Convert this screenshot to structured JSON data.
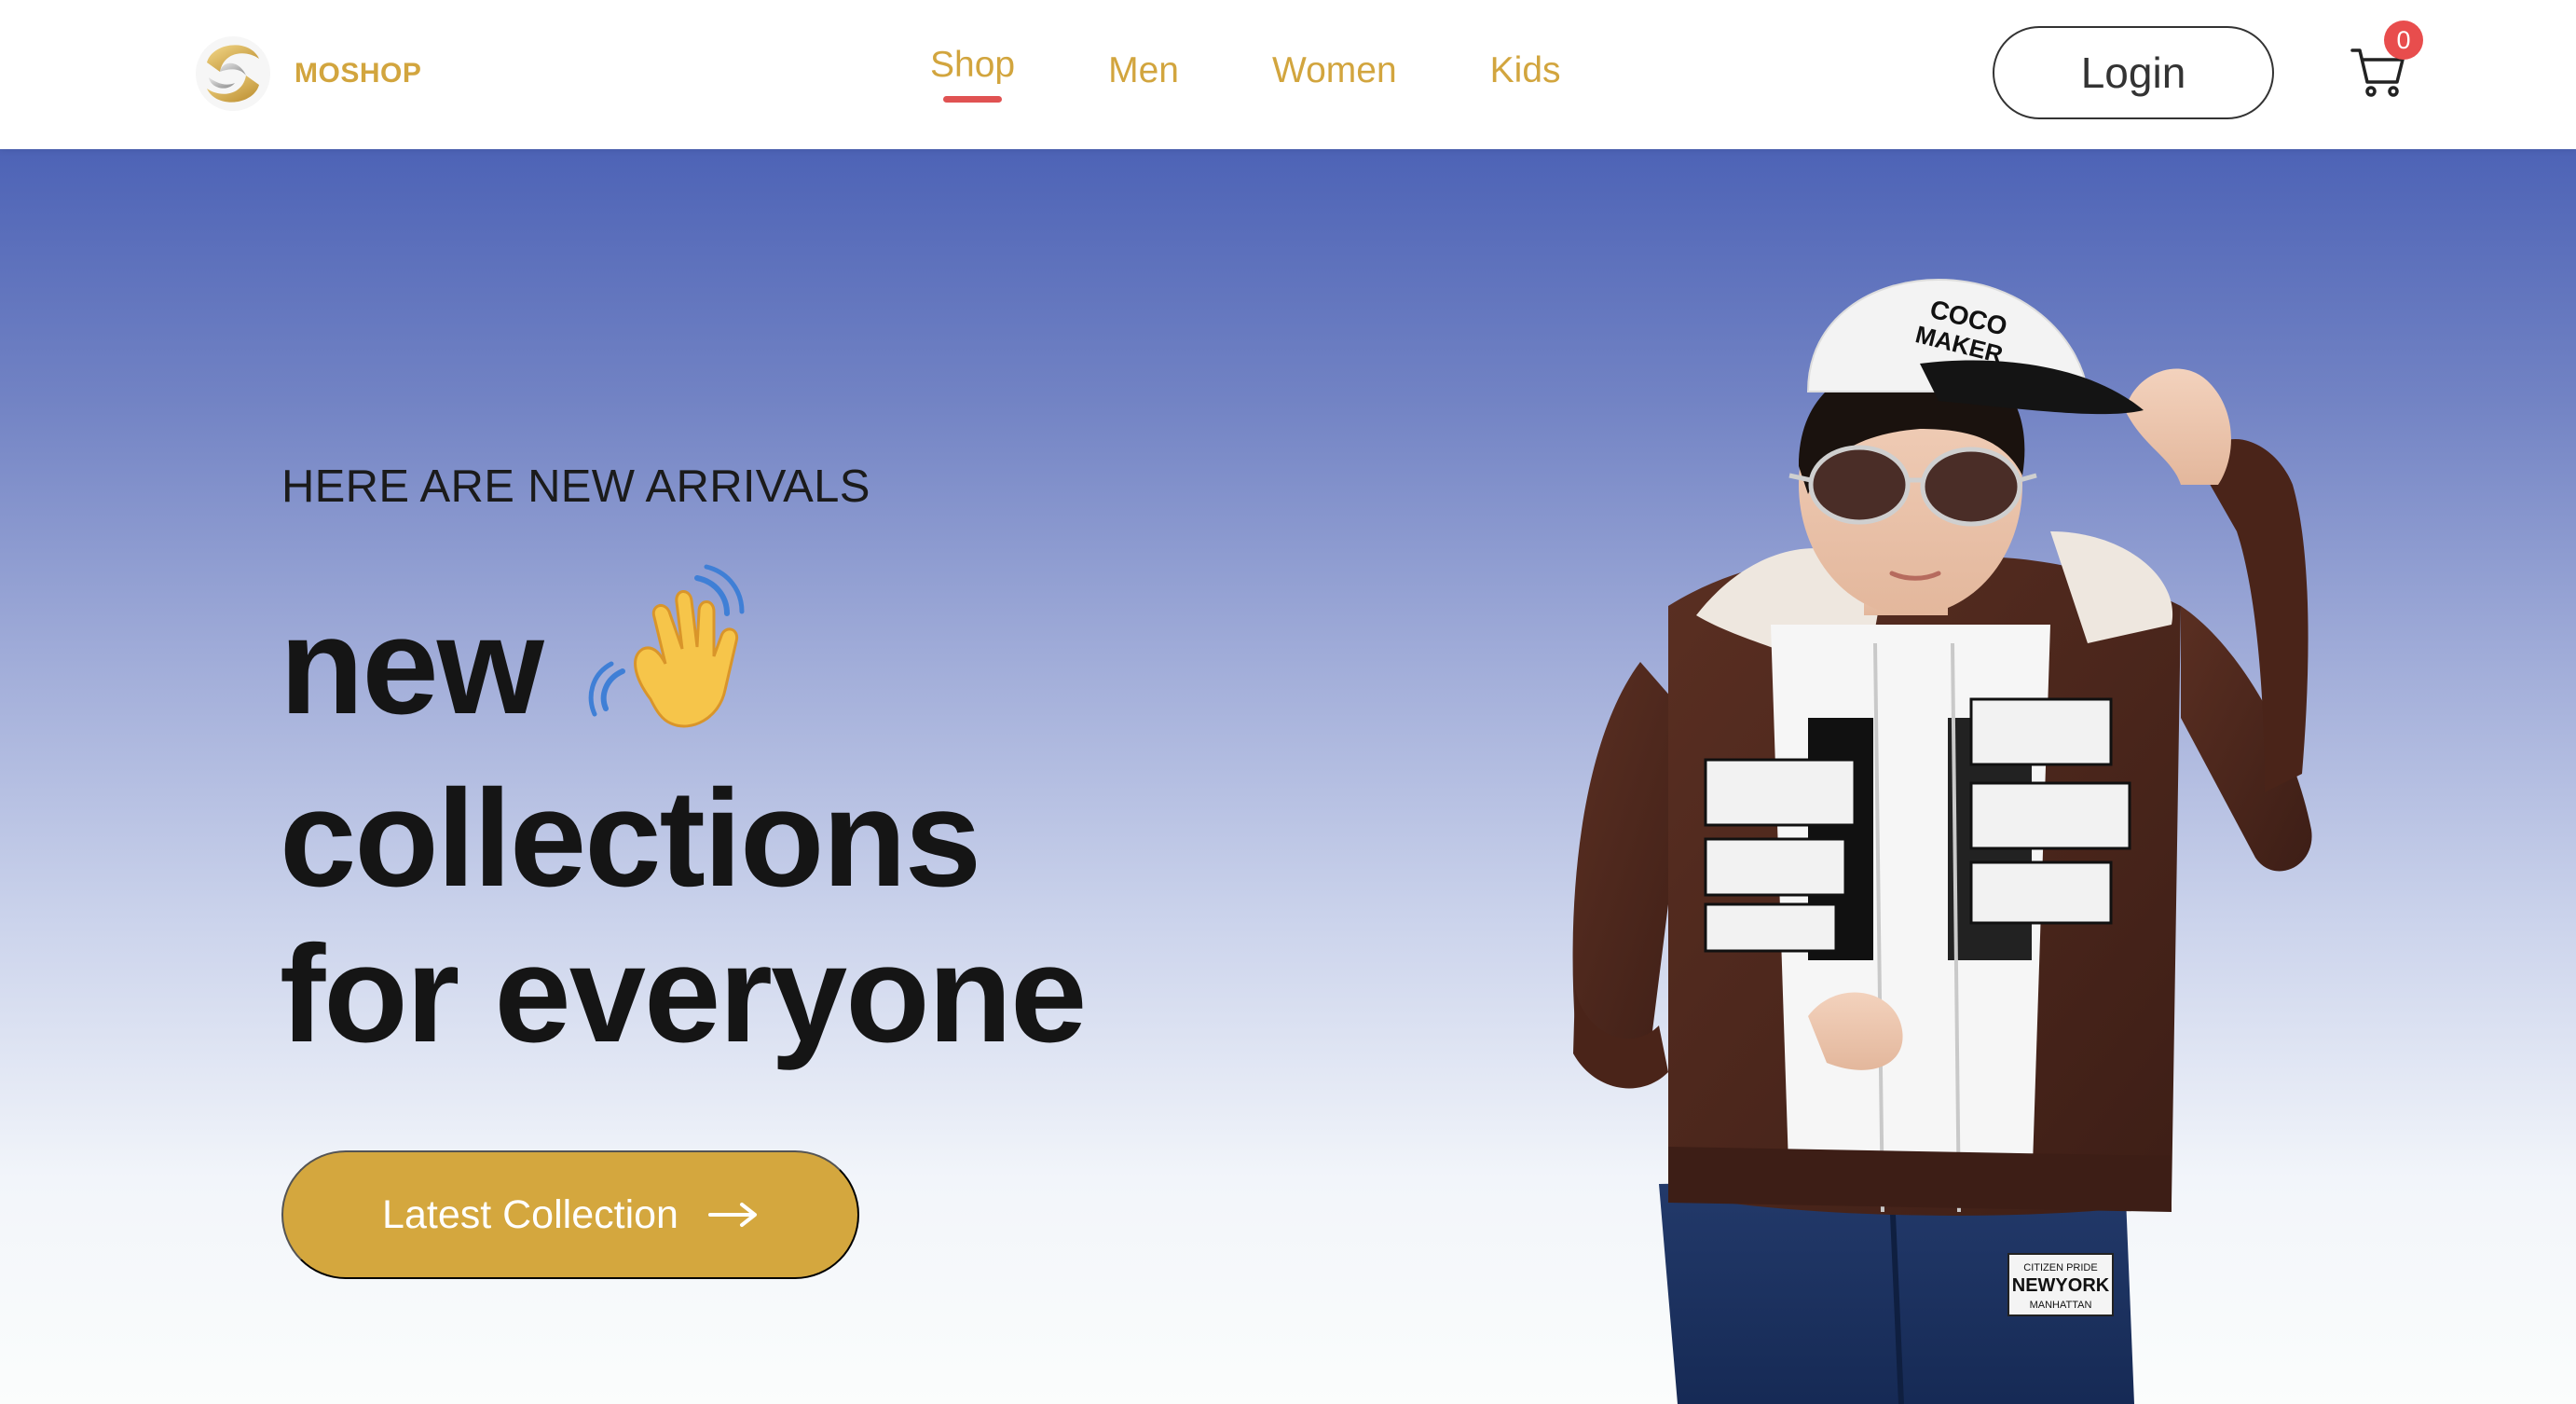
{
  "brand": {
    "name": "MOSHOP",
    "logo_icon": "swirl-logo-icon"
  },
  "nav": {
    "items": [
      {
        "label": "Shop",
        "active": true
      },
      {
        "label": "Men",
        "active": false
      },
      {
        "label": "Women",
        "active": false
      },
      {
        "label": "Kids",
        "active": false
      }
    ]
  },
  "header": {
    "login_label": "Login",
    "cart_icon": "shopping-cart-icon",
    "cart_count": "0"
  },
  "hero": {
    "eyebrow": "HERE ARE NEW ARRIVALS",
    "headline_line1": "new",
    "headline_line2": "collections",
    "headline_line3": "for everyone",
    "emoji": "waving-hand-icon",
    "cta_label": "Latest Collection",
    "cta_icon": "arrow-right-icon",
    "model_image": "boy-model-image",
    "cap_text_1": "COCO",
    "cap_text_2": "MAKER",
    "patch_text_1": "CITIZEN PRIDE",
    "patch_text_2": "NEWYORK",
    "patch_text_3": "MANHATTAN"
  },
  "colors": {
    "accent_gold": "#d4a73e",
    "active_underline": "#e05252",
    "hero_top": "#4d63b6",
    "hero_bottom": "#fbfdfc",
    "badge_red": "#e84d4d"
  }
}
